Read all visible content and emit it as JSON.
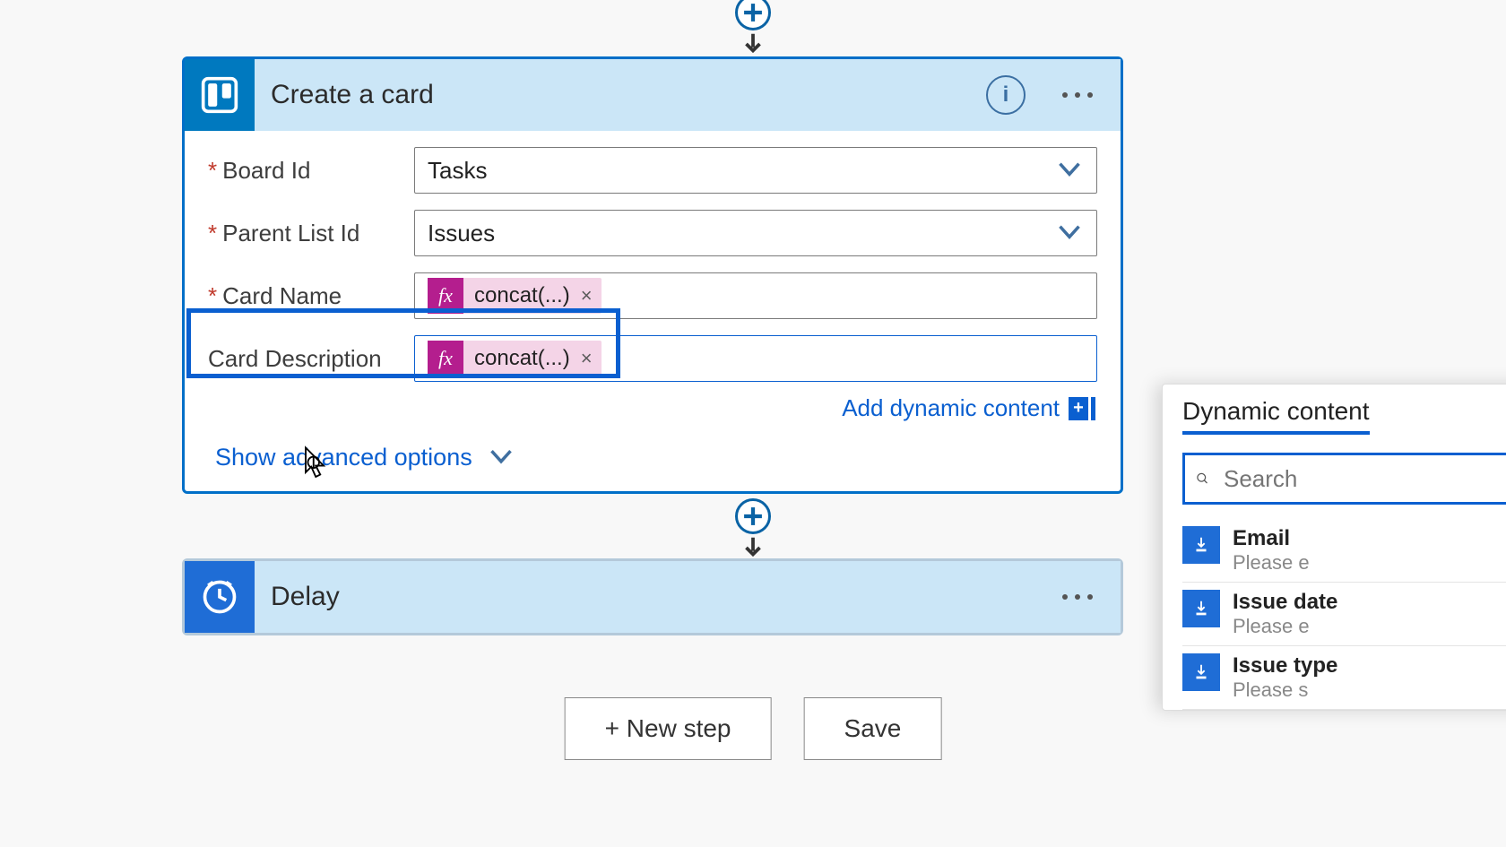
{
  "connectors": {
    "add_step_tooltip": "+"
  },
  "createCard": {
    "title": "Create a card",
    "fields": {
      "boardId": {
        "label": "Board Id",
        "value": "Tasks",
        "required": true
      },
      "parentList": {
        "label": "Parent List Id",
        "value": "Issues",
        "required": true
      },
      "cardName": {
        "label": "Card Name",
        "token": "concat(...)",
        "required": true
      },
      "cardDesc": {
        "label": "Card Description",
        "token": "concat(...)",
        "required": false
      }
    },
    "addDynamic": "Add dynamic content",
    "showAdvanced": "Show advanced options"
  },
  "delayCard": {
    "title": "Delay"
  },
  "bottom": {
    "newStep": "+ New step",
    "save": "Save"
  },
  "dynamicPanel": {
    "tab": "Dynamic content",
    "searchPlaceholder": "Search",
    "items": [
      {
        "title": "Email",
        "subtitle": "Please e"
      },
      {
        "title": "Issue date",
        "subtitle": "Please e"
      },
      {
        "title": "Issue type",
        "subtitle": "Please s"
      }
    ]
  },
  "icons": {
    "fx": "fx",
    "close": "×",
    "info": "i"
  }
}
